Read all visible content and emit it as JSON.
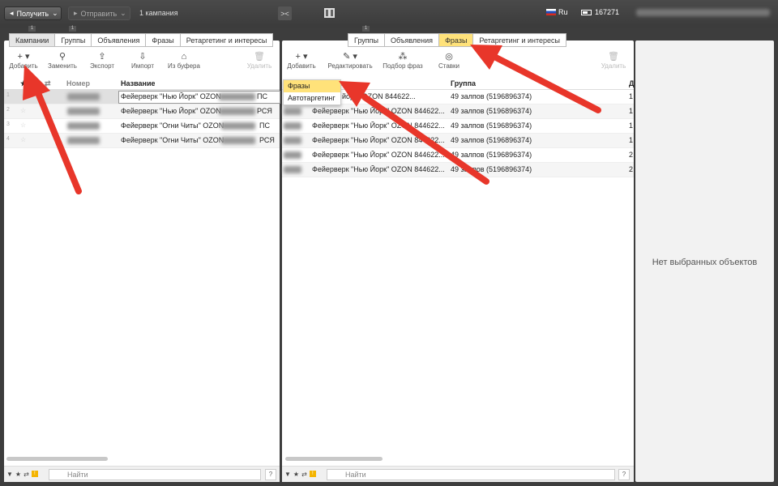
{
  "topbar": {
    "get_label": "Получить",
    "send_label": "Отправить",
    "campaign_count": "1 кампания",
    "lang": "Ru",
    "balance": "167271"
  },
  "left_panel": {
    "tabs": [
      "Кампании",
      "Группы",
      "Объявления",
      "Фразы",
      "Ретаргетинг и интересы"
    ],
    "tab_markers": [
      "1",
      "1"
    ],
    "toolbar": {
      "add": "Добавить",
      "replace": "Заменить",
      "export": "Экспорт",
      "import": "Импорт",
      "from_buffer": "Из буфера",
      "delete": "Удалить"
    },
    "columns": {
      "number": "Номер",
      "name": "Название"
    },
    "rows": [
      {
        "n": "1",
        "name": "Фейерверк \"Нью Йорк\" OZON",
        "suffix": "ПС"
      },
      {
        "n": "2",
        "name": "Фейерверк \"Нью Йорк\" OZON",
        "suffix": "РСЯ"
      },
      {
        "n": "3",
        "name": "Фейерверк \"Огни Читы\" OZON",
        "suffix": "ПС"
      },
      {
        "n": "4",
        "name": "Фейерверк \"Огни Читы\" OZON",
        "suffix": "РСЯ"
      }
    ],
    "search_placeholder": "Найти",
    "help": "?"
  },
  "mid_panel": {
    "tabs": [
      "Группы",
      "Объявления",
      "Фразы",
      "Ретаргетинг и интересы"
    ],
    "tab_marker": "1",
    "toolbar": {
      "add": "Добавить",
      "edit": "Редактировать",
      "phrase_pick": "Подбор фраз",
      "bids": "Ставки",
      "delete": "Удалить"
    },
    "columns": {
      "name_tail": "ия",
      "group": "Группа",
      "last": "Д"
    },
    "rows": [
      {
        "name": "йорк\" OZON 844622...",
        "group": "49 залпов (5196896374)",
        "d": "1"
      },
      {
        "name": "Фейерверк \"Нью Йорк\" OZON 844622...",
        "group": "49 залпов (5196896374)",
        "d": "1"
      },
      {
        "name": "Фейерверк \"Нью Йорк\" OZON 844622...",
        "group": "49 залпов (5196896374)",
        "d": "1"
      },
      {
        "name": "Фейерверк \"Нью Йорк\" OZON 844622...",
        "group": "49 залпов (5196896374)",
        "d": "1"
      },
      {
        "name": "Фейерверк \"Нью Йорк\" OZON 844622...",
        "group": "49 залпов (5196896374)",
        "d": "2"
      },
      {
        "name": "Фейерверк \"Нью Йорк\" OZON 844622...",
        "group": "49 залпов (5196896374)",
        "d": "2"
      }
    ],
    "dropdown": [
      "Фразы",
      "Автотаргетинг"
    ],
    "search_placeholder": "Найти",
    "help": "?"
  },
  "right_panel": {
    "empty_text": "Нет выбранных объектов"
  },
  "colors": {
    "highlight_yellow": "#ffe27a",
    "arrow_red": "#e8362a"
  }
}
